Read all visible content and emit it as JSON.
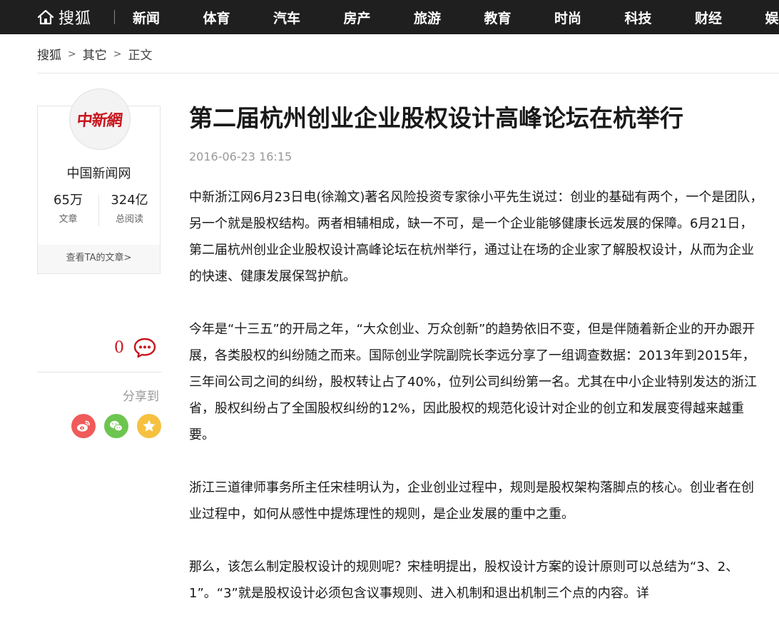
{
  "header": {
    "logo_text": "搜狐",
    "nav": [
      "新闻",
      "体育",
      "汽车",
      "房产",
      "旅游",
      "教育",
      "时尚",
      "科技",
      "财经",
      "娱乐"
    ]
  },
  "breadcrumb": [
    "搜狐",
    "其它",
    "正文"
  ],
  "author": {
    "avatar_text": "中新網",
    "name": "中国新闻网",
    "stats": [
      {
        "value": "65万",
        "label": "文章"
      },
      {
        "value": "324亿",
        "label": "总阅读"
      }
    ],
    "link_label": "查看TA的文章>"
  },
  "comments": {
    "count": "0"
  },
  "share": {
    "label": "分享到"
  },
  "article": {
    "title": "第二届杭州创业企业股权设计高峰论坛在杭举行",
    "time": "2016-06-23 16:15",
    "paragraphs": [
      "中新浙江网6月23日电(徐瀚文)著名风险投资专家徐小平先生说过：创业的基础有两个，一个是团队，另一个就是股权结构。两者相辅相成，缺一不可，是一个企业能够健康长远发展的保障。6月21日，第二届杭州创业企业股权设计高峰论坛在杭州举行，通过让在场的企业家了解股权设计，从而为企业的快速、健康发展保驾护航。",
      "今年是“十三五”的开局之年，“大众创业、万众创新”的趋势依旧不变，但是伴随着新企业的开办跟开展，各类股权的纠纷随之而来。国际创业学院副院长李远分享了一组调查数据：2013年到2015年，三年间公司之间的纠纷，股权转让占了40%，位列公司纠纷第一名。尤其在中小企业特别发达的浙江省，股权纠纷占了全国股权纠纷的12%，因此股权的规范化设计对企业的创立和发展变得越来越重要。",
      "浙江三道律师事务所主任宋桂明认为，企业创业过程中，规则是股权架构落脚点的核心。创业者在创业过程中，如何从感性中提炼理性的规则，是企业发展的重中之重。",
      "那么，该怎么制定股权设计的规则呢？宋桂明提出，股权设计方案的设计原则可以总结为“3、2、1”。“3”就是股权设计必须包含议事规则、进入机制和退出机制三个点的内容。详"
    ]
  }
}
